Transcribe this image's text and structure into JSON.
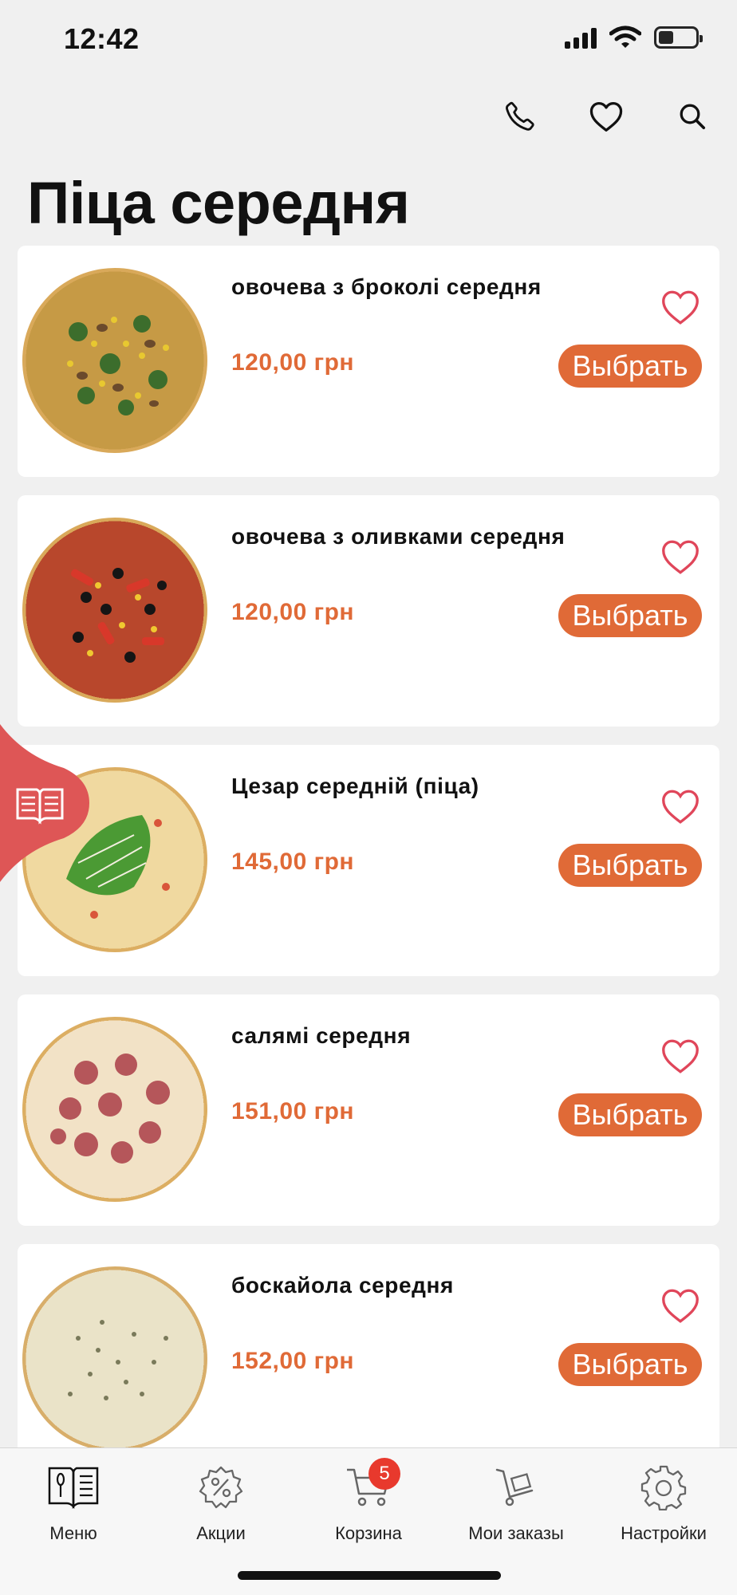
{
  "status": {
    "time": "12:42"
  },
  "page": {
    "title": "Піца середня"
  },
  "products": [
    {
      "name": "овочева з броколі середня",
      "price": "120,00 грн",
      "button": "Выбрать",
      "pizza": "veggie-broccoli"
    },
    {
      "name": "овочева з оливками середня",
      "price": "120,00 грн",
      "button": "Выбрать",
      "pizza": "veggie-olives"
    },
    {
      "name": "Цезар середній (піца)",
      "price": "145,00 грн",
      "button": "Выбрать",
      "pizza": "caesar"
    },
    {
      "name": "салямі середня",
      "price": "151,00 грн",
      "button": "Выбрать",
      "pizza": "salami"
    },
    {
      "name": "боскайола середня",
      "price": "152,00 грн",
      "button": "Выбрать",
      "pizza": "boscaiola"
    }
  ],
  "tabbar": {
    "items": [
      {
        "label": "Меню",
        "icon": "menu-book-icon"
      },
      {
        "label": "Акции",
        "icon": "discount-icon"
      },
      {
        "label": "Корзина",
        "icon": "cart-icon",
        "badge": "5"
      },
      {
        "label": "Мои заказы",
        "icon": "orders-trolley-icon"
      },
      {
        "label": "Настройки",
        "icon": "gear-icon"
      }
    ]
  },
  "colors": {
    "accent": "#e06a37",
    "badge": "#e8392d",
    "side_tab": "#de5656",
    "heart": "#e0465a",
    "background": "#f0f0f0"
  }
}
